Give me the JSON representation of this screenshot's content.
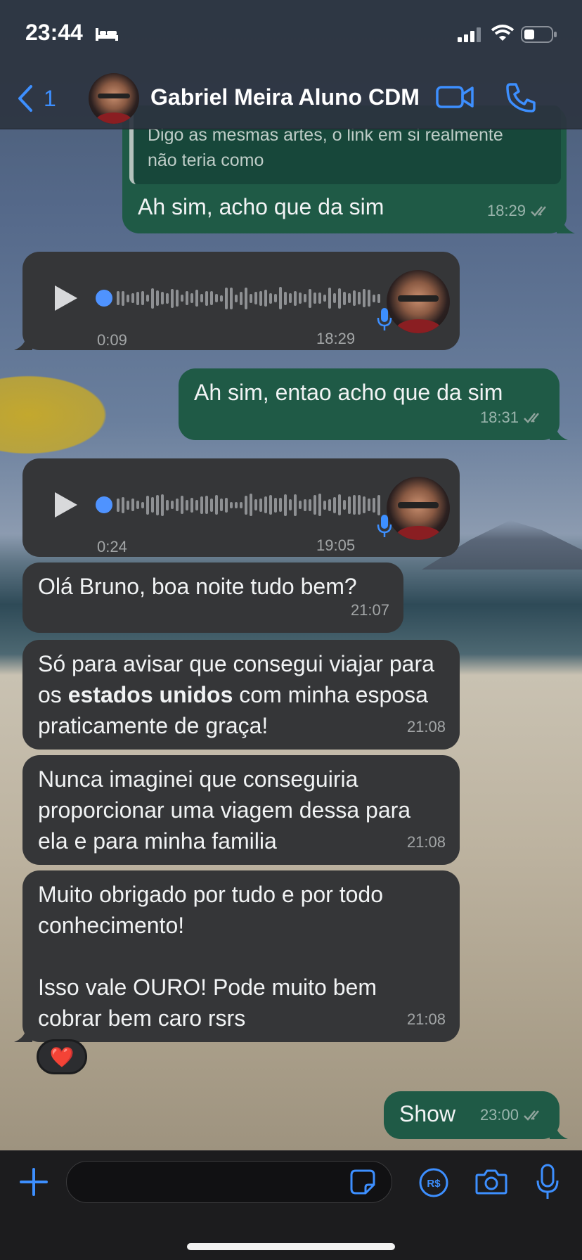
{
  "status_bar": {
    "time": "23:44"
  },
  "header": {
    "back_count": "1",
    "contact_name": "Gabriel Meira Aluno CDM"
  },
  "messages": {
    "m1": {
      "quote_text_line1": "Digo as mesmas artes, o link em si realmente",
      "quote_text_line2": "não teria como",
      "text": "Ah sim, acho que da sim",
      "time": "18:29"
    },
    "v1": {
      "duration": "0:09",
      "time": "18:29"
    },
    "m2": {
      "text": "Ah sim, entao acho que da sim",
      "time": "18:31"
    },
    "v2": {
      "duration": "0:24",
      "time": "19:05"
    },
    "m3": {
      "text": "Olá Bruno, boa noite tudo bem?",
      "time": "21:07"
    },
    "m4": {
      "text_before": "Só para avisar que consegui viajar para os ",
      "text_bold": "estados unidos",
      "text_after": " com minha esposa praticamente de graça!",
      "time": "21:08"
    },
    "m5": {
      "text": "Nunca imaginei que conseguiria proporcionar uma viagem dessa para ela e para minha familia",
      "time": "21:08"
    },
    "m6": {
      "text_p1": "Muito obrigado por tudo e por todo conhecimento!",
      "text_p2": "Isso vale OURO! Pode muito bem cobrar bem caro rsrs",
      "time": "21:08",
      "reaction": "❤️"
    },
    "m7": {
      "text": "Show",
      "time": "23:00"
    }
  },
  "composer": {
    "placeholder": ""
  },
  "colors": {
    "accent": "#3d8fff",
    "incoming_bubble": "#353638",
    "outgoing_bubble": "#1f5a46"
  }
}
